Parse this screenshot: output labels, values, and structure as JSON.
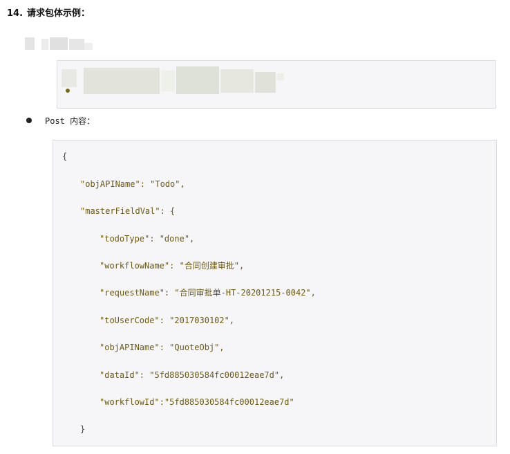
{
  "heading": {
    "number": "14.",
    "title": "请求包体示例："
  },
  "bullet": {
    "label": "Post 内容："
  },
  "code": {
    "lines": [
      "{",
      "\"objAPIName\": \"Todo\",",
      "\"masterFieldVal\": {",
      "\"todoType\": \"done\",",
      "\"workflowName\": \"合同创建审批\",",
      "\"requestName\": \"合同审批单-HT-20201215-0042\",",
      "\"toUserCode\": \"2017030102\",",
      "\"objAPIName\": \"QuoteObj\",",
      "\"dataId\": \"5fd885030584fc00012eae7d\",",
      "\"workflowId\":\"5fd885030584fc00012eae7d\"",
      "}"
    ]
  },
  "colors": {
    "code_text": "#6b5a12",
    "code_background": "#f6f6f8",
    "code_border": "#dcdce4"
  }
}
